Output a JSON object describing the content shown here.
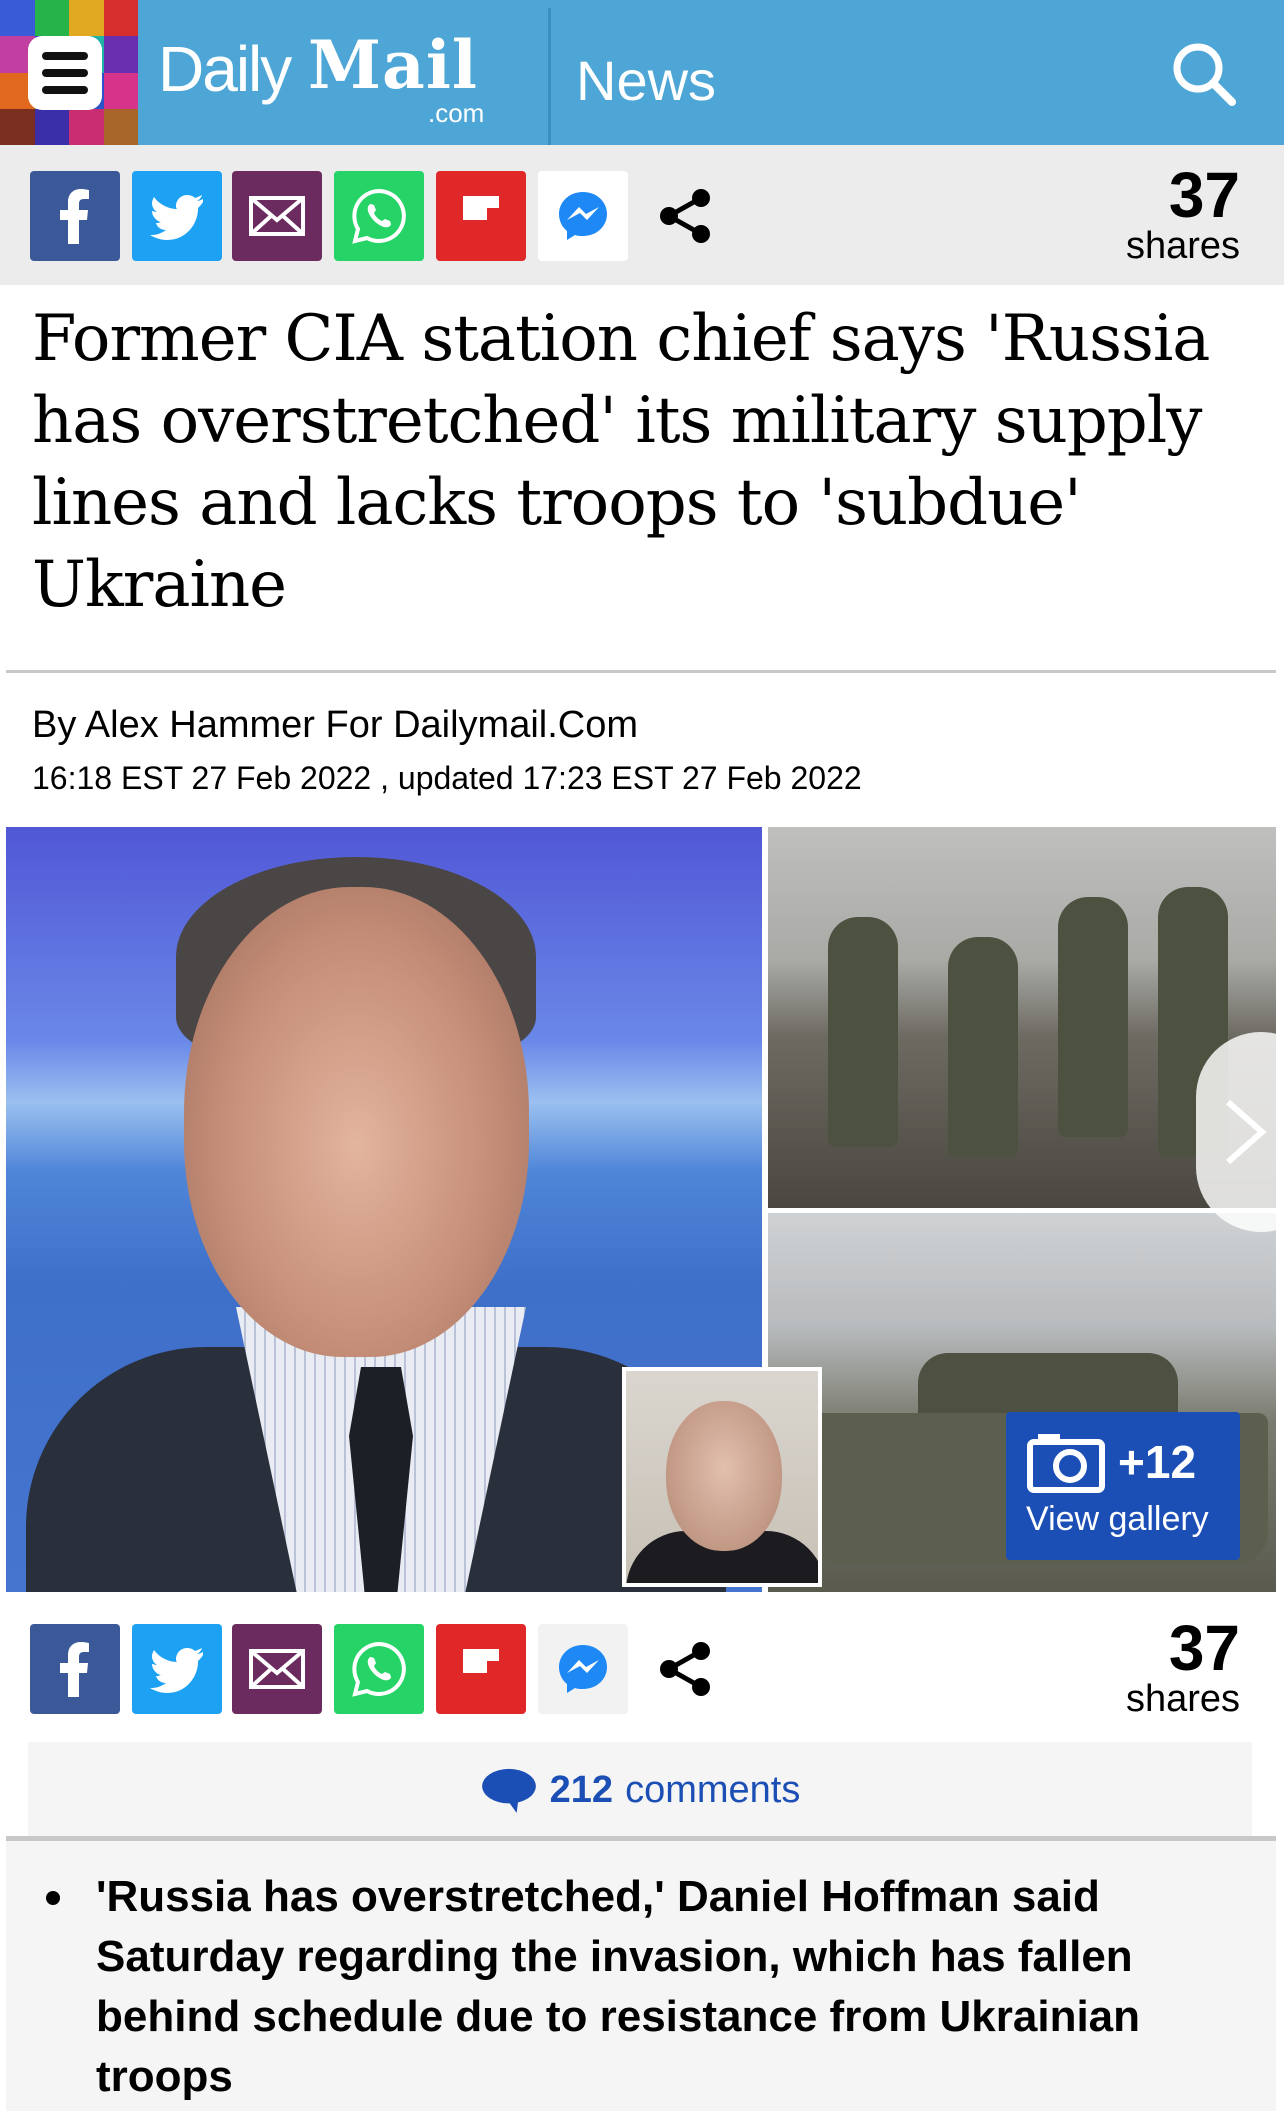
{
  "header": {
    "logo_daily": "Daily",
    "logo_mail": "Mail",
    "logo_com": ".com",
    "section": "News",
    "brand_color": "#4da6d6"
  },
  "share_bar": {
    "buttons": [
      {
        "name": "facebook",
        "color": "#3b5998",
        "icon": "facebook-icon"
      },
      {
        "name": "twitter",
        "color": "#1da1f2",
        "icon": "twitter-icon"
      },
      {
        "name": "email",
        "color": "#6b2b5e",
        "icon": "mail-icon"
      },
      {
        "name": "whatsapp",
        "color": "#25d366",
        "icon": "whatsapp-icon"
      },
      {
        "name": "flipboard",
        "color": "#e12828",
        "icon": "flipboard-icon"
      },
      {
        "name": "messenger",
        "color": "#ffffff",
        "icon": "messenger-icon"
      },
      {
        "name": "share",
        "color": "#000000",
        "icon": "share-icon"
      }
    ],
    "count": "37",
    "count_label": "shares"
  },
  "article": {
    "headline": "Former CIA station chief says 'Russia has overstretched' its military supply lines and lacks troops to 'subdue' Ukraine",
    "byline": "By Alex Hammer For Dailymail.Com",
    "dateline": "16:18 EST 27 Feb 2022 , updated 17:23 EST 27 Feb 2022"
  },
  "gallery": {
    "count": "+12",
    "label": "View gallery"
  },
  "comments": {
    "count": "212",
    "label": "comments",
    "color": "#1b4fb5"
  },
  "summary": {
    "bullets": [
      "'Russia has overstretched,' Daniel Hoffman said Saturday regarding the invasion, which has fallen behind schedule due to resistance from Ukrainian troops"
    ]
  }
}
